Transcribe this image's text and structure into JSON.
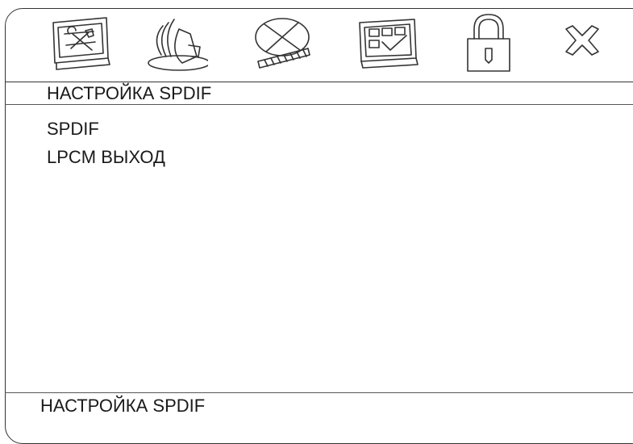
{
  "tabs": [
    {
      "icon": "general-setup-icon"
    },
    {
      "icon": "audio-setup-icon"
    },
    {
      "icon": "video-setup-icon"
    },
    {
      "icon": "preferences-icon"
    },
    {
      "icon": "password-lock-icon"
    },
    {
      "icon": "exit-icon"
    }
  ],
  "header": {
    "title": "НАСТРОЙКА SPDIF"
  },
  "menu": {
    "items": [
      {
        "label": "SPDIF"
      },
      {
        "label": "LPCM ВЫХОД"
      }
    ]
  },
  "status": {
    "text": "НАСТРОЙКА SPDIF"
  }
}
